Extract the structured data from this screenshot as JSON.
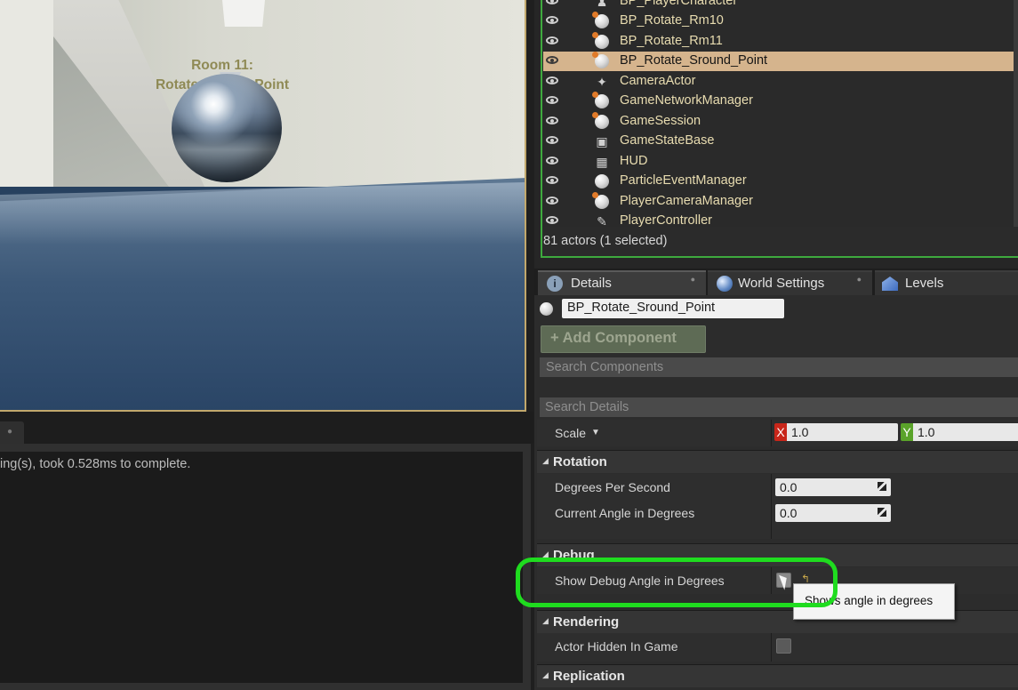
{
  "viewport": {
    "room_label_line1": "Room 11:",
    "room_label_line2": "Rotate Around Point"
  },
  "output_log": {
    "last_line": "ing(s), took 0.528ms to complete."
  },
  "outliner": {
    "items": [
      {
        "label": "BP_PlayerCharacter",
        "icon": "pawn-icon"
      },
      {
        "label": "BP_Rotate_Rm10",
        "icon": "blueprint-actor-icon"
      },
      {
        "label": "BP_Rotate_Rm11",
        "icon": "blueprint-actor-icon"
      },
      {
        "label": "BP_Rotate_Sround_Point",
        "icon": "blueprint-actor-icon",
        "selected": true
      },
      {
        "label": "CameraActor",
        "icon": "camera-icon"
      },
      {
        "label": "GameNetworkManager",
        "icon": "blueprint-actor-icon"
      },
      {
        "label": "GameSession",
        "icon": "blueprint-actor-icon"
      },
      {
        "label": "GameStateBase",
        "icon": "game-state-icon"
      },
      {
        "label": "HUD",
        "icon": "hud-icon"
      },
      {
        "label": "ParticleEventManager",
        "icon": "actor-icon"
      },
      {
        "label": "PlayerCameraManager",
        "icon": "blueprint-actor-icon"
      },
      {
        "label": "PlayerController",
        "icon": "player-controller-icon"
      }
    ],
    "footer": "81 actors (1 selected)"
  },
  "tabs": [
    {
      "label": "Details",
      "active": true
    },
    {
      "label": "World Settings",
      "active": false
    },
    {
      "label": "Levels",
      "active": false
    }
  ],
  "details": {
    "actor_name": "BP_Rotate_Sround_Point",
    "add_component_label": "+ Add Component",
    "search_components_placeholder": "Search Components",
    "search_details_placeholder": "Search Details",
    "scale": {
      "label": "Scale",
      "x": "1.0",
      "y": "1.0"
    },
    "rotation": {
      "title": "Rotation",
      "degrees_per_second_label": "Degrees Per Second",
      "degrees_per_second_value": "0.0",
      "current_angle_label": "Current Angle in Degrees",
      "current_angle_value": "0.0"
    },
    "debug": {
      "title": "Debug",
      "show_debug_label": "Show Debug Angle in Degrees",
      "tooltip": "Shows angle in degrees"
    },
    "rendering": {
      "title": "Rendering",
      "actor_hidden_label": "Actor Hidden In Game"
    },
    "replication": {
      "title": "Replication"
    }
  },
  "colors": {
    "selection": "#d5b48d",
    "highlight_ring": "#1fdc1f",
    "outliner_border": "#3ea93e",
    "viewport_border": "#c2a86c",
    "x_axis": "#c8261a",
    "y_axis": "#5aa32a"
  }
}
